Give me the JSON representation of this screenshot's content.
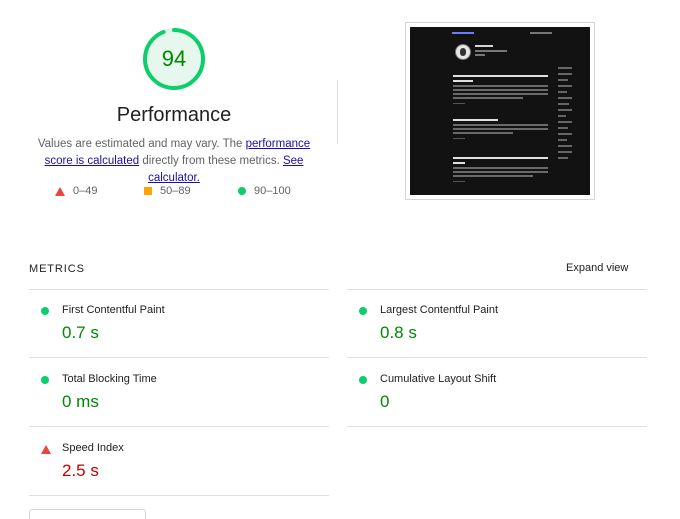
{
  "score": {
    "value": "94",
    "fraction": 0.94,
    "title": "Performance",
    "desc_prefix": "Values are estimated and may vary. The ",
    "link1": "performance score is calculated",
    "desc_middle": " directly from these metrics. ",
    "link2": "See calculator.",
    "colors": {
      "pass": "#0cce6b",
      "pass_text": "#008800",
      "track": "#e6f7ee"
    }
  },
  "legend": [
    {
      "shape": "triangle",
      "label": "0–49",
      "color": "#e8453c"
    },
    {
      "shape": "square",
      "label": "50–89",
      "color": "#ffa400"
    },
    {
      "shape": "circle",
      "label": "90–100",
      "color": "#0cce6b"
    }
  ],
  "metrics_section": {
    "header": "METRICS",
    "expand": "Expand view",
    "items": [
      {
        "name": "First Contentful Paint",
        "value": "0.7 s",
        "status": "pass"
      },
      {
        "name": "Largest Contentful Paint",
        "value": "0.8 s",
        "status": "pass"
      },
      {
        "name": "Total Blocking Time",
        "value": "0 ms",
        "status": "pass"
      },
      {
        "name": "Cumulative Layout Shift",
        "value": "0",
        "status": "pass"
      },
      {
        "name": "Speed Index",
        "value": "2.5 s",
        "status": "fail"
      }
    ]
  }
}
